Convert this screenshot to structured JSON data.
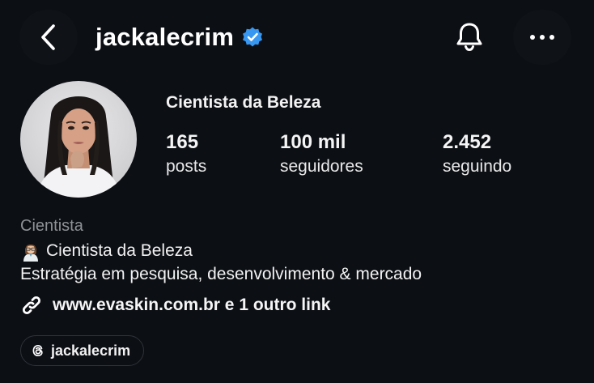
{
  "header": {
    "username": "jackalecrim",
    "verified": true,
    "back_icon": "chevron-left-icon",
    "bell_icon": "bell-icon",
    "more_icon": "more-horizontal-icon"
  },
  "profile": {
    "display_name": "Cientista da Beleza",
    "stats": [
      {
        "value": "165",
        "label": "posts"
      },
      {
        "value": "100 mil",
        "label": "seguidores"
      },
      {
        "value": "2.452",
        "label": "seguindo"
      }
    ]
  },
  "bio": {
    "category": "Cientista",
    "line1": "Cientista da Beleza",
    "line1_emoji": "woman-scientist-emoji",
    "line2": "Estratégia em pesquisa, desenvolvimento & mercado",
    "link": "www.evaskin.com.br e 1 outro link"
  },
  "threads": {
    "label": "jackalecrim",
    "icon": "threads-icon"
  },
  "colors": {
    "background": "#0c0f14",
    "verified_badge": "#3897f0",
    "secondary_text": "#8e9196"
  }
}
